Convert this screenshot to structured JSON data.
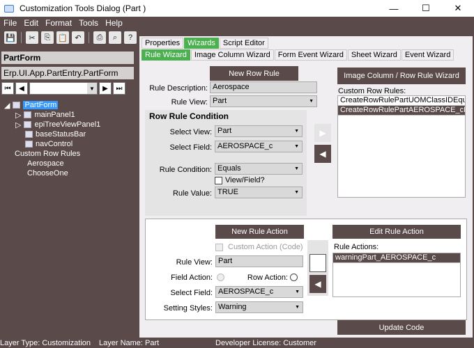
{
  "window": {
    "title": "Customization Tools Dialog  (Part )",
    "min": "—",
    "max": "☐",
    "close": "✕"
  },
  "menu": [
    "File",
    "Edit",
    "Format",
    "Tools",
    "Help"
  ],
  "toolbar_icons": [
    "save-icon",
    "cut-icon",
    "copy-icon",
    "paste-icon",
    "undo-icon",
    "print-icon",
    "search-icon",
    "help-icon"
  ],
  "left": {
    "header": "PartForm",
    "path": "Erp.UI.App.PartEntry.PartForm",
    "nav_select": "",
    "tree": [
      {
        "label": "PartForm",
        "selected": true
      },
      {
        "label": "mainPanel1"
      },
      {
        "label": "epiTreeViewPanel1"
      },
      {
        "label": "baseStatusBar"
      },
      {
        "label": "navControl"
      },
      {
        "label": "Custom Row Rules"
      },
      {
        "label": "Aerospace"
      },
      {
        "label": "ChooseOne"
      }
    ]
  },
  "tabs": [
    "Properties",
    "Wizards",
    "Script Editor"
  ],
  "subtabs": [
    "Rule Wizard",
    "Image Column Wizard",
    "Form Event Wizard",
    "Sheet Wizard",
    "Event Wizard"
  ],
  "rule": {
    "new_row_rule": "New Row Rule",
    "desc_label": "Rule Description:",
    "desc_value": "Aerospace",
    "view_label": "Rule View:",
    "view_value": "Part",
    "condition_title": "Row Rule Condition",
    "select_view_label": "Select View:",
    "select_view": "Part",
    "select_field_label": "Select Field:",
    "select_field": "AEROSPACE_c",
    "rule_condition_label": "Rule Condition:",
    "rule_condition": "Equals",
    "view_field_label": "View/Field?",
    "rule_value_label": "Rule Value:",
    "rule_value": "TRUE"
  },
  "custom": {
    "image_wizard_btn": "Image Column / Row Rule Wizard",
    "custom_rules_label": "Custom Row Rules:",
    "rules": [
      "CreateRowRulePartUOMClassIDEqu...",
      "CreateRowRulePartAEROSPACE_cE..."
    ]
  },
  "action": {
    "new_rule_action": "New Rule Action",
    "custom_action": "Custom Action (Code)",
    "rule_view_label": "Rule View:",
    "rule_view": "Part",
    "field_action_label": "Field Action:",
    "row_action_label": "Row Action:",
    "select_field_label": "Select Field:",
    "select_field": "AEROSPACE_c",
    "setting_styles_label": "Setting Styles:",
    "setting_styles": "Warning",
    "edit_rule_action": "Edit Rule Action",
    "rule_actions_label": "Rule Actions:",
    "rule_actions": [
      "warningPart_AEROSPACE_c"
    ],
    "update_code": "Update Code"
  },
  "status": {
    "layer_type": "Layer Type:  Customization",
    "layer_name": "Layer Name:  Part",
    "dev_license": "Developer License:  Customer"
  }
}
